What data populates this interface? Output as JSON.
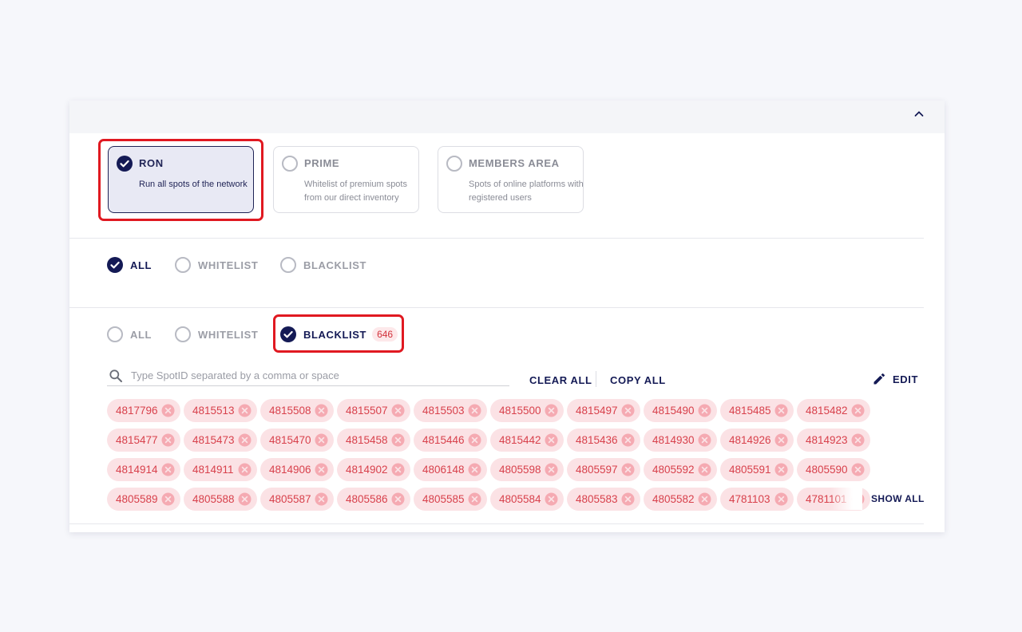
{
  "cards": [
    {
      "title": "RON",
      "description": "Run all spots of the network",
      "selected": true
    },
    {
      "title": "PRIME",
      "description": "Whitelist of premium spots from our direct inventory",
      "selected": false
    },
    {
      "title": "MEMBERS AREA",
      "description": "Spots of online platforms with registered users",
      "selected": false
    }
  ],
  "filter1": {
    "all": "ALL",
    "whitelist": "WHITELIST",
    "blacklist": "BLACKLIST",
    "selected": "ALL"
  },
  "filter2": {
    "all": "ALL",
    "whitelist": "WHITELIST",
    "blacklist": "BLACKLIST",
    "selected": "BLACKLIST",
    "blacklist_count": "646"
  },
  "search": {
    "placeholder": "Type SpotID separated by a comma or space"
  },
  "actions": {
    "clear_all": "CLEAR ALL",
    "copy_all": "COPY ALL",
    "edit": "EDIT",
    "show_all": "SHOW ALL"
  },
  "spot_ids": [
    "4817796",
    "4815513",
    "4815508",
    "4815507",
    "4815503",
    "4815500",
    "4815497",
    "4815490",
    "4815485",
    "4815482",
    "4815477",
    "4815473",
    "4815470",
    "4815458",
    "4815446",
    "4815442",
    "4815436",
    "4814930",
    "4814926",
    "4814923",
    "4814914",
    "4814911",
    "4814906",
    "4814902",
    "4806148",
    "4805598",
    "4805597",
    "4805592",
    "4805591",
    "4805590",
    "4805589",
    "4805588",
    "4805587",
    "4805586",
    "4805585",
    "4805584",
    "4805583",
    "4805582",
    "4781103",
    "4781101"
  ],
  "colors": {
    "accent": "#141a55",
    "highlight": "#e01921",
    "chip_bg": "#fbe2e5",
    "chip_text": "#d8414c"
  }
}
